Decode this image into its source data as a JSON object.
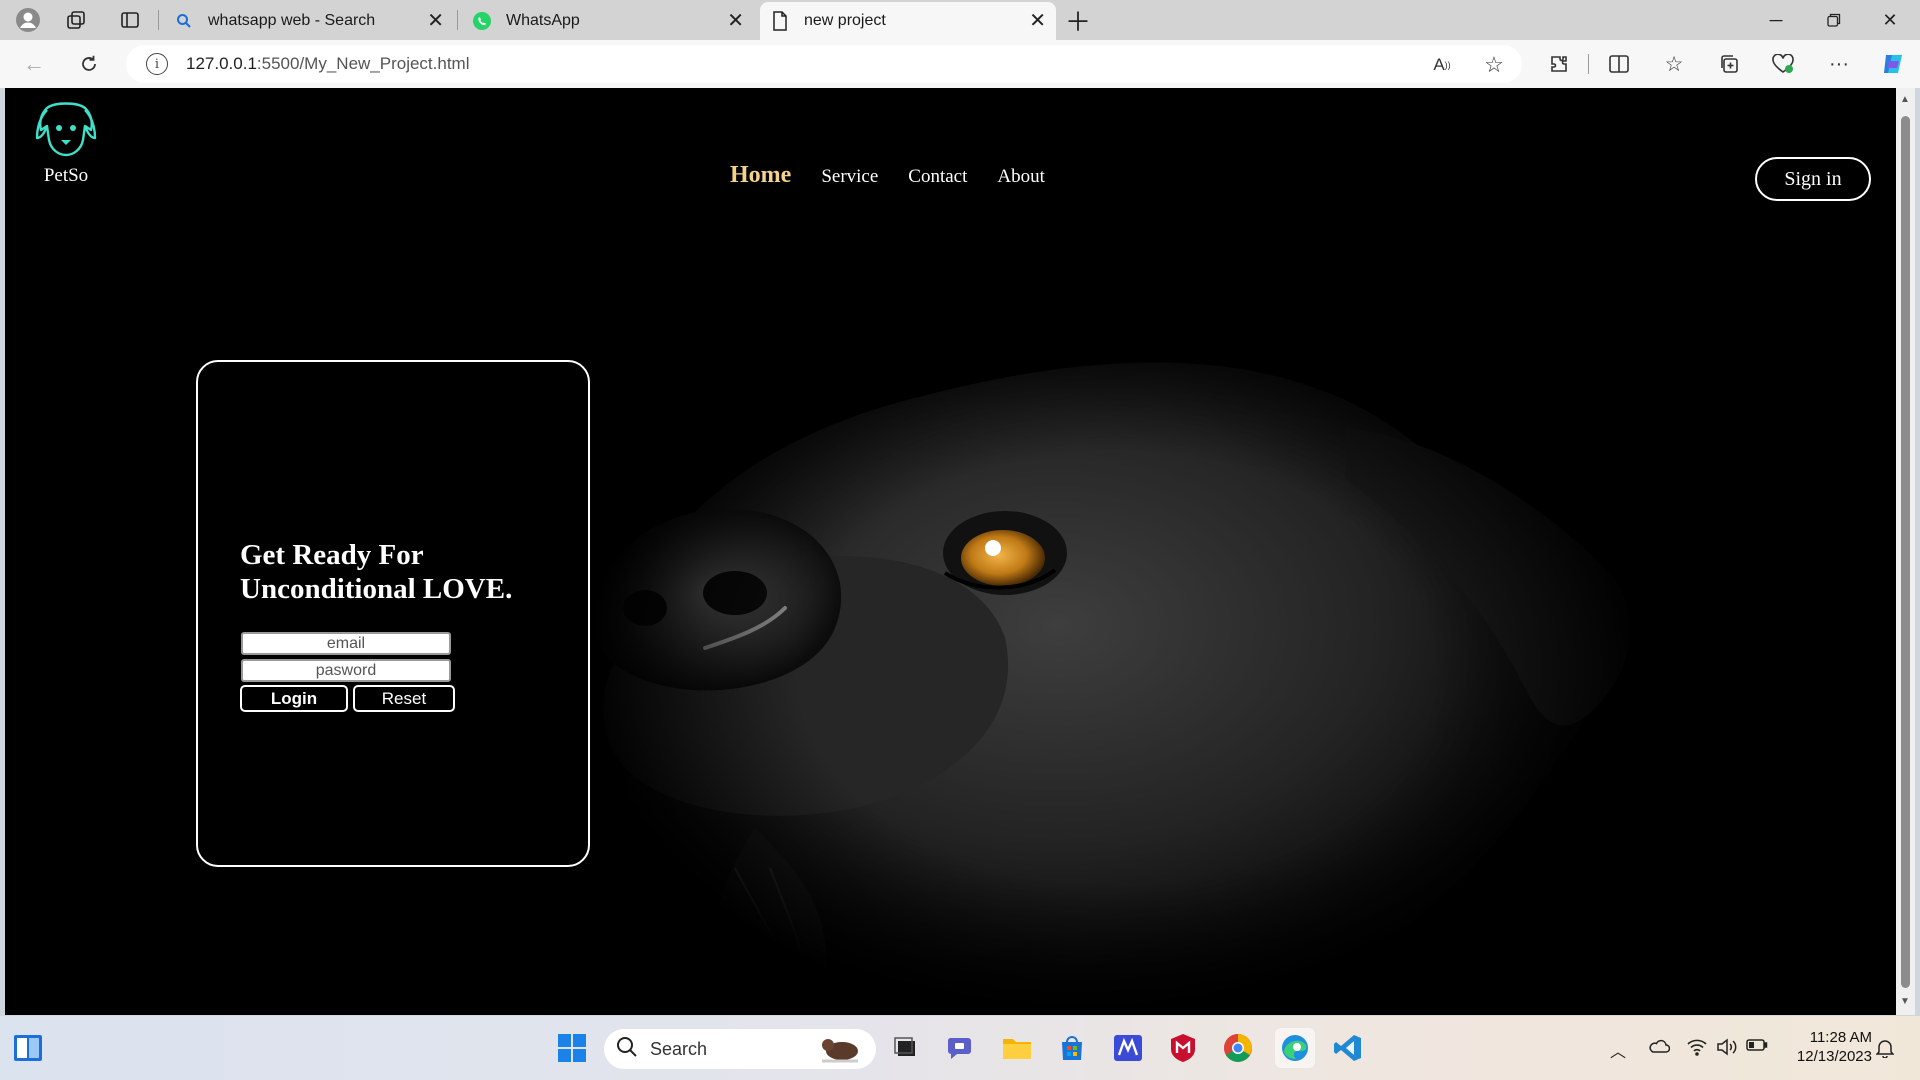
{
  "browser": {
    "tabs": [
      {
        "title": "whatsapp web - Search",
        "icon": "search-icon"
      },
      {
        "title": "WhatsApp",
        "icon": "whatsapp-icon"
      },
      {
        "title": "new project",
        "icon": "page-icon",
        "active": true
      }
    ],
    "url_host": "127.0.0.1",
    "url_path": ":5500/My_New_Project.html"
  },
  "page": {
    "brand": "PetSo",
    "nav": [
      {
        "label": "Home",
        "active": true
      },
      {
        "label": "Service"
      },
      {
        "label": "Contact"
      },
      {
        "label": "About"
      }
    ],
    "signin_label": "Sign in",
    "headline_1": "Get Ready For",
    "headline_2": "Unconditional LOVE.",
    "email_placeholder": "email",
    "password_placeholder": "pasword",
    "login_label": "Login",
    "reset_label": "Reset",
    "accent_color": "#f4d28b",
    "logo_color": "#3fe0c9"
  },
  "taskbar": {
    "search_label": "Search",
    "time": "11:28 AM",
    "date": "12/13/2023"
  }
}
